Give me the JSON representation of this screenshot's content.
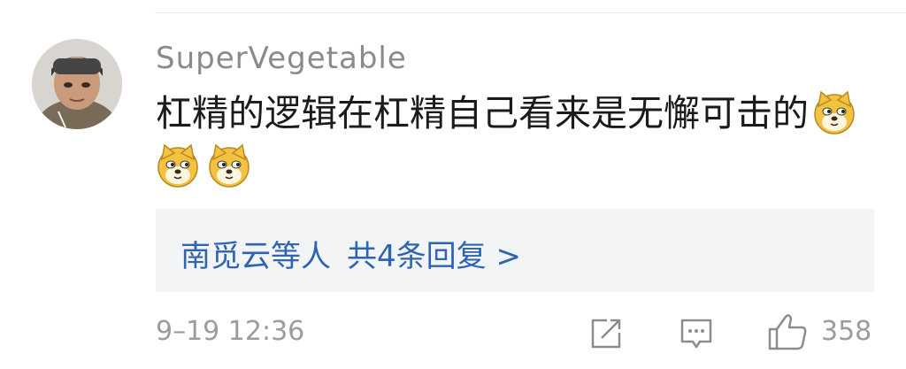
{
  "comment": {
    "username": "SuperVegetable",
    "text": "杠精的逻辑在杠精自己看来是无懈可击的",
    "emojis": [
      "doge-emoji",
      "doge-emoji",
      "doge-emoji"
    ]
  },
  "replies": {
    "names": "南觅云等人",
    "count_label": "共4条回复 >"
  },
  "meta": {
    "timestamp": "9–19 12:36",
    "like_count": "358"
  },
  "icons": {
    "share": "share-icon",
    "comment": "comment-icon",
    "like": "thumbs-up-icon"
  },
  "colors": {
    "username": "#8a8a8a",
    "text": "#1b1b1b",
    "reply_link": "#2f64b3",
    "reply_bg": "#f3f4f6",
    "meta": "#9c9c9c"
  }
}
